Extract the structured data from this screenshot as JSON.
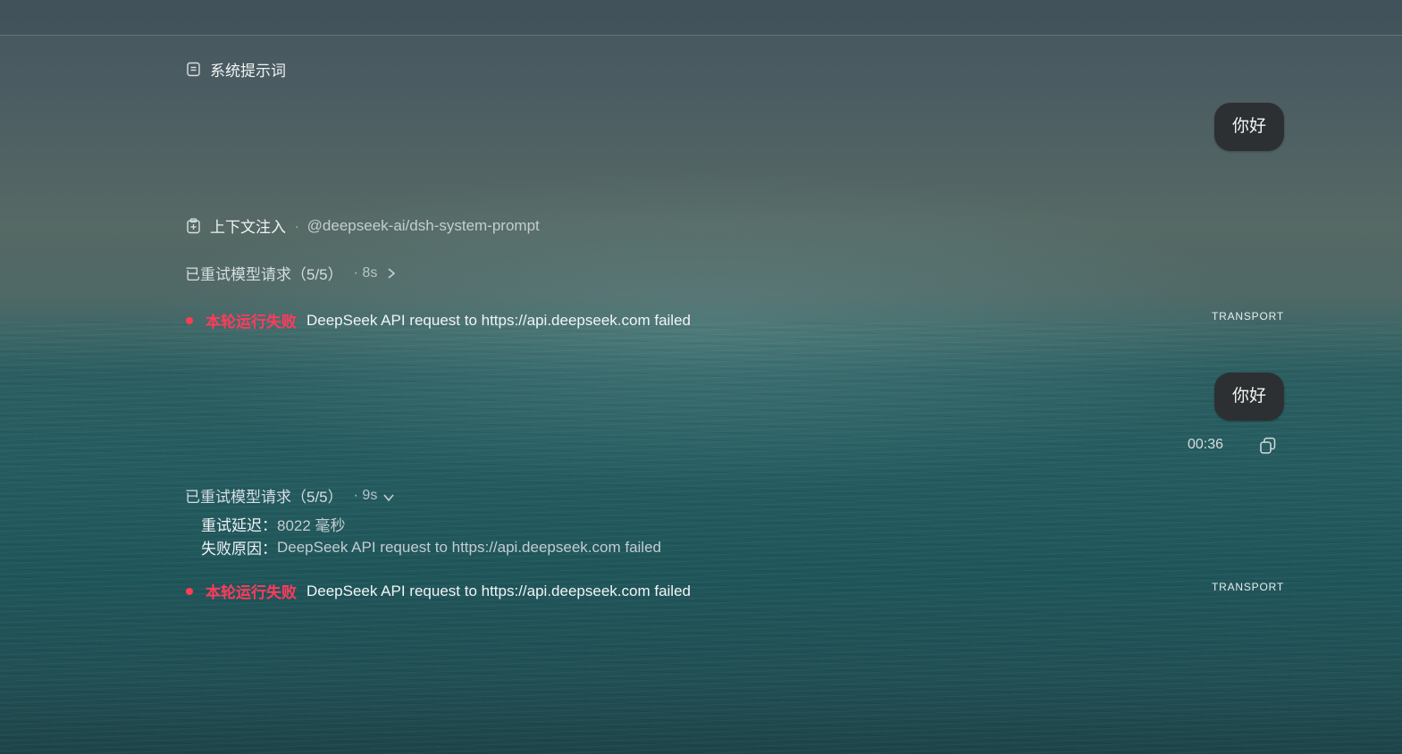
{
  "system_prompt": {
    "icon": "document-icon",
    "label": "系统提示词"
  },
  "messages": [
    {
      "role": "user",
      "text": "你好"
    },
    {
      "role": "user",
      "text": "你好",
      "time": "00:36",
      "copy_icon": "copy-icon"
    }
  ],
  "context_injection": {
    "icon": "clipboard-icon",
    "label": "上下文注入",
    "separator": "·",
    "source": "@deepseek-ai/dsh-system-prompt"
  },
  "retry_blocks": [
    {
      "title": "已重试模型请求（5/5）",
      "meta": "· 8s",
      "expanded": false,
      "chevron_icon": "chevron-right-icon"
    },
    {
      "title": "已重试模型请求（5/5）",
      "meta": "· 9s",
      "expanded": true,
      "chevron_icon": "chevron-down-icon",
      "details": [
        {
          "key": "重试延迟：",
          "value": "8022 毫秒"
        },
        {
          "key": "失败原因：",
          "value": "DeepSeek API request to https://api.deepseek.com failed"
        }
      ]
    }
  ],
  "errors": [
    {
      "label": "本轮运行失败",
      "message": "DeepSeek API request to https://api.deepseek.com failed",
      "tag": "TRANSPORT"
    },
    {
      "label": "本轮运行失败",
      "message": "DeepSeek API request to https://api.deepseek.com failed",
      "tag": "TRANSPORT"
    }
  ],
  "colors": {
    "error": "#ff3b5c",
    "bubble": "#2d3032"
  }
}
